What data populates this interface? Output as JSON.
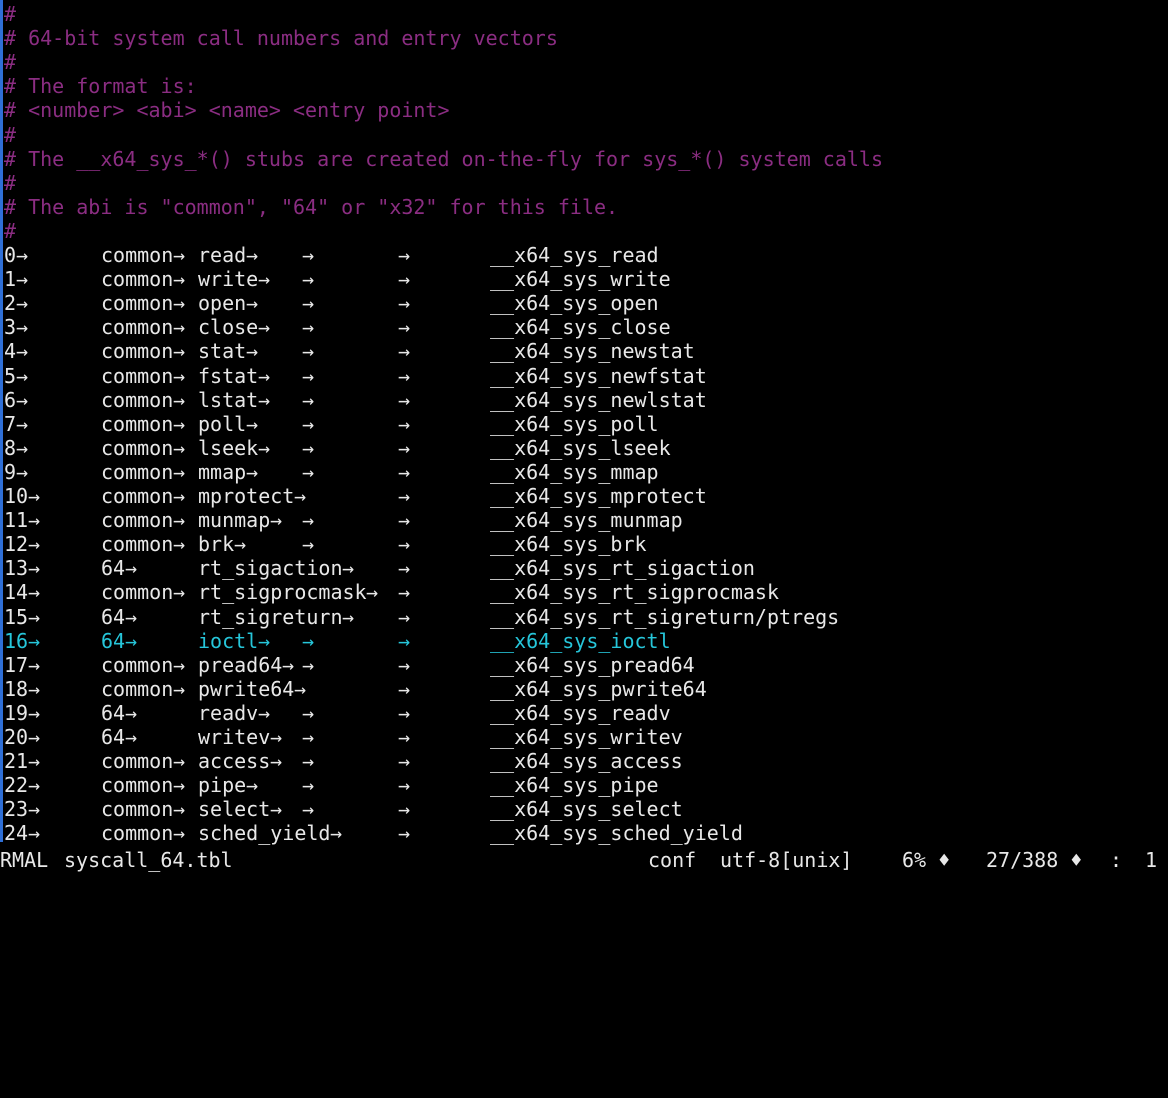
{
  "comments": [
    "#",
    "# 64-bit system call numbers and entry vectors",
    "#",
    "# The format is:",
    "# <number> <abi> <name> <entry point>",
    "#",
    "# The __x64_sys_*() stubs are created on-the-fly for sys_*() system calls",
    "#",
    "# The abi is \"common\", \"64\" or \"x32\" for this file.",
    "#"
  ],
  "tab_glyph": "→",
  "syscalls": [
    {
      "num": "0",
      "abi": "common",
      "name": "read",
      "entry": "__x64_sys_read"
    },
    {
      "num": "1",
      "abi": "common",
      "name": "write",
      "entry": "__x64_sys_write"
    },
    {
      "num": "2",
      "abi": "common",
      "name": "open",
      "entry": "__x64_sys_open"
    },
    {
      "num": "3",
      "abi": "common",
      "name": "close",
      "entry": "__x64_sys_close"
    },
    {
      "num": "4",
      "abi": "common",
      "name": "stat",
      "entry": "__x64_sys_newstat"
    },
    {
      "num": "5",
      "abi": "common",
      "name": "fstat",
      "entry": "__x64_sys_newfstat"
    },
    {
      "num": "6",
      "abi": "common",
      "name": "lstat",
      "entry": "__x64_sys_newlstat"
    },
    {
      "num": "7",
      "abi": "common",
      "name": "poll",
      "entry": "__x64_sys_poll"
    },
    {
      "num": "8",
      "abi": "common",
      "name": "lseek",
      "entry": "__x64_sys_lseek"
    },
    {
      "num": "9",
      "abi": "common",
      "name": "mmap",
      "entry": "__x64_sys_mmap"
    },
    {
      "num": "10",
      "abi": "common",
      "name": "mprotect",
      "entry": "__x64_sys_mprotect"
    },
    {
      "num": "11",
      "abi": "common",
      "name": "munmap",
      "entry": "__x64_sys_munmap"
    },
    {
      "num": "12",
      "abi": "common",
      "name": "brk",
      "entry": "__x64_sys_brk"
    },
    {
      "num": "13",
      "abi": "64",
      "name": "rt_sigaction",
      "entry": "__x64_sys_rt_sigaction"
    },
    {
      "num": "14",
      "abi": "common",
      "name": "rt_sigprocmask",
      "entry": "__x64_sys_rt_sigprocmask"
    },
    {
      "num": "15",
      "abi": "64",
      "name": "rt_sigreturn",
      "entry": "__x64_sys_rt_sigreturn/ptregs"
    },
    {
      "num": "16",
      "abi": "64",
      "name": "ioctl",
      "entry": "__x64_sys_ioctl",
      "cursor": true
    },
    {
      "num": "17",
      "abi": "common",
      "name": "pread64",
      "entry": "__x64_sys_pread64"
    },
    {
      "num": "18",
      "abi": "common",
      "name": "pwrite64",
      "entry": "__x64_sys_pwrite64"
    },
    {
      "num": "19",
      "abi": "64",
      "name": "readv",
      "entry": "__x64_sys_readv"
    },
    {
      "num": "20",
      "abi": "64",
      "name": "writev",
      "entry": "__x64_sys_writev"
    },
    {
      "num": "21",
      "abi": "common",
      "name": "access",
      "entry": "__x64_sys_access"
    },
    {
      "num": "22",
      "abi": "common",
      "name": "pipe",
      "entry": "__x64_sys_pipe"
    },
    {
      "num": "23",
      "abi": "common",
      "name": "select",
      "entry": "__x64_sys_select"
    },
    {
      "num": "24",
      "abi": "common",
      "name": "sched_yield",
      "entry": "__x64_sys_sched_yield"
    }
  ],
  "statusline": {
    "mode": "RMAL",
    "filename": "syscall_64.tbl",
    "filetype": "conf",
    "encoding": "utf-8[unix]",
    "percent": "6% ♦",
    "position": "27/388 ♦",
    "separator": ":",
    "column": "1"
  },
  "colors": {
    "background": "#000000",
    "text": "#e8e8e8",
    "comment": "#8b2d82",
    "cursorline": "#26c6da",
    "left_bar": "#2f6fd6"
  }
}
